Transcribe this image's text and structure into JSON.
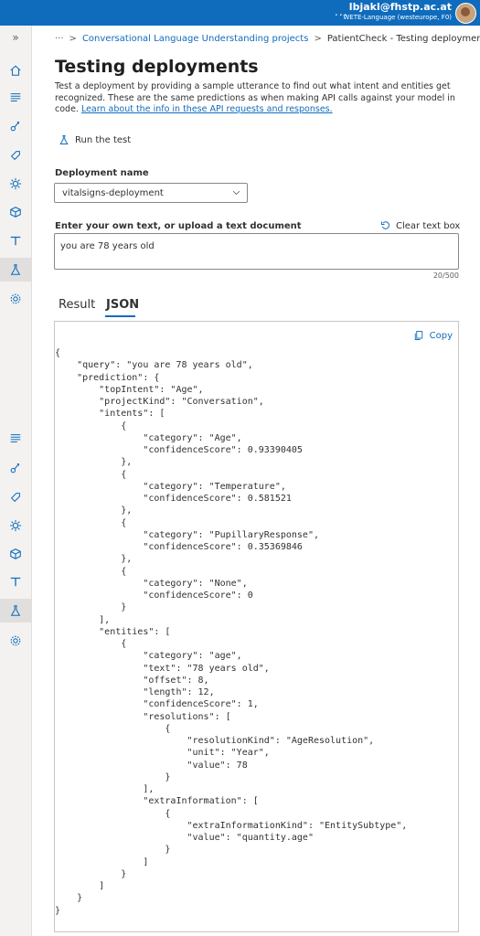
{
  "topbar": {
    "more": "...",
    "user_email": "lbjakl@fhstp.ac.at",
    "user_directory": "WETE-Language (westeurope, F0)"
  },
  "sidebar": {
    "expand_icon": "chevron-double-right-icon",
    "items": [
      {
        "icon": "home-icon"
      },
      {
        "icon": "utterances-icon"
      },
      {
        "icon": "schema-icon"
      },
      {
        "icon": "tag-icon"
      },
      {
        "icon": "training-icon"
      },
      {
        "icon": "model-icon"
      },
      {
        "icon": "deploy-icon"
      },
      {
        "icon": "flask-icon",
        "active": true
      },
      {
        "icon": "settings-icon"
      },
      {
        "icon": "utterances-icon"
      },
      {
        "icon": "schema-icon"
      },
      {
        "icon": "tag-icon"
      },
      {
        "icon": "training-icon"
      },
      {
        "icon": "model-icon"
      },
      {
        "icon": "deploy-icon"
      },
      {
        "icon": "flask-icon",
        "active": true
      },
      {
        "icon": "settings-icon"
      }
    ]
  },
  "breadcrumb": {
    "ellipsis": "···",
    "separator": ">",
    "project": "Conversational Language Understanding projects",
    "current": "PatientCheck - Testing deployments"
  },
  "page": {
    "title": "Testing deployments",
    "description": "Test a deployment by providing a sample utterance to find out what intent and entities get recognized. These are the same predictions as when making API calls against your model in code. ",
    "learn_link": "Learn about the info in these API requests and responses."
  },
  "toolbar": {
    "run_label": "Run the test"
  },
  "deployment": {
    "label": "Deployment name",
    "value": "vitalsigns-deployment"
  },
  "input": {
    "label": "Enter your own text, or upload a text document",
    "clear_label": "Clear text box",
    "value": "you are 78 years old",
    "counter": "20/500"
  },
  "tabs": {
    "result": "Result",
    "json": "JSON",
    "active": "JSON"
  },
  "json_view": {
    "copy_label": "Copy",
    "code": "{\n    \"query\": \"you are 78 years old\",\n    \"prediction\": {\n        \"topIntent\": \"Age\",\n        \"projectKind\": \"Conversation\",\n        \"intents\": [\n            {\n                \"category\": \"Age\",\n                \"confidenceScore\": 0.93390405\n            },\n            {\n                \"category\": \"Temperature\",\n                \"confidenceScore\": 0.581521\n            },\n            {\n                \"category\": \"PupillaryResponse\",\n                \"confidenceScore\": 0.35369846\n            },\n            {\n                \"category\": \"None\",\n                \"confidenceScore\": 0\n            }\n        ],\n        \"entities\": [\n            {\n                \"category\": \"age\",\n                \"text\": \"78 years old\",\n                \"offset\": 8,\n                \"length\": 12,\n                \"confidenceScore\": 1,\n                \"resolutions\": [\n                    {\n                        \"resolutionKind\": \"AgeResolution\",\n                        \"unit\": \"Year\",\n                        \"value\": 78\n                    }\n                ],\n                \"extraInformation\": [\n                    {\n                        \"extraInformationKind\": \"EntitySubtype\",\n                        \"value\": \"quantity.age\"\n                    }\n                ]\n            }\n        ]\n    }\n}"
  },
  "colors": {
    "accent": "#0f6cbd",
    "sidebar_bg": "#f3f2f1",
    "text": "#323130"
  }
}
